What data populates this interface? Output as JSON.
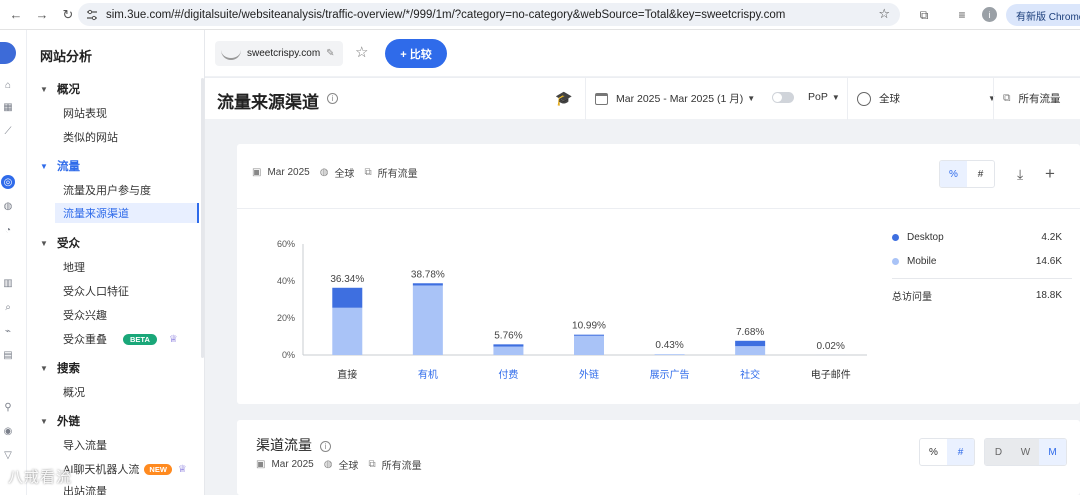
{
  "browser": {
    "url": "sim.3ue.com/#/digitalsuite/websiteanalysis/traffic-overview/*/999/1m/?category=no-category&webSource=Total&key=sweetcrispy.com",
    "update_label": "有新版 Chrome"
  },
  "sidebar": {
    "title": "网站分析",
    "groups": [
      {
        "label": "概况",
        "items": [
          "网站表现",
          "类似的网站"
        ]
      },
      {
        "label": "流量",
        "items": [
          "流量及用户参与度",
          "流量来源渠道"
        ]
      },
      {
        "label": "受众",
        "items": [
          "地理",
          "受众人口特征",
          "受众兴趣",
          "受众重叠"
        ]
      },
      {
        "label": "搜索",
        "items": [
          "概况"
        ]
      },
      {
        "label": "外链",
        "items": [
          "导入流量",
          "AI聊天机器人流",
          "出站流量"
        ]
      }
    ],
    "beta_badge": "BETA",
    "new_badge": "NEW"
  },
  "topbar": {
    "site": "sweetcrispy.com",
    "compare_label": "+ 比较"
  },
  "header": {
    "title": "流量来源渠道",
    "date_range": "Mar 2025 - Mar 2025 (1 月)",
    "pop": "PoP",
    "region": "全球",
    "traffic": "所有流量"
  },
  "card1": {
    "date": "Mar 2025",
    "region": "全球",
    "traffic": "所有流量",
    "pct_btn": "%",
    "num_btn": "#",
    "legend": [
      {
        "name": "Desktop",
        "value": "4.2K",
        "color": "#3e6fe0"
      },
      {
        "name": "Mobile",
        "value": "14.6K",
        "color": "#a9c3f7"
      }
    ],
    "total_label": "总访问量",
    "total_value": "18.8K"
  },
  "chart_data": {
    "type": "bar",
    "categories": [
      "直接",
      "有机",
      "付费",
      "外链",
      "展示广告",
      "社交",
      "电子邮件"
    ],
    "series": [
      {
        "name": "Desktop",
        "values": [
          10.8,
          1.2,
          1.2,
          0.6,
          0.0,
          2.9,
          0.0
        ]
      },
      {
        "name": "Mobile",
        "values": [
          25.54,
          37.58,
          4.56,
          10.39,
          0.43,
          4.78,
          0.02
        ]
      }
    ],
    "totals": [
      36.34,
      38.78,
      5.76,
      10.99,
      0.43,
      7.68,
      0.02
    ],
    "data_labels": [
      "36.34%",
      "38.78%",
      "5.76%",
      "10.99%",
      "0.43%",
      "7.68%",
      "0.02%"
    ],
    "yticks": [
      "60%",
      "40%",
      "20%",
      "0%"
    ],
    "ylim": [
      0,
      60
    ],
    "stacked": true,
    "grid": false,
    "legend": "right"
  },
  "card2": {
    "title": "渠道流量",
    "date": "Mar 2025",
    "region": "全球",
    "traffic": "所有流量",
    "pct_btn": "%",
    "num_btn": "#",
    "d_btn": "D",
    "w_btn": "W",
    "m_btn": "M"
  },
  "watermark": "八戒看流"
}
